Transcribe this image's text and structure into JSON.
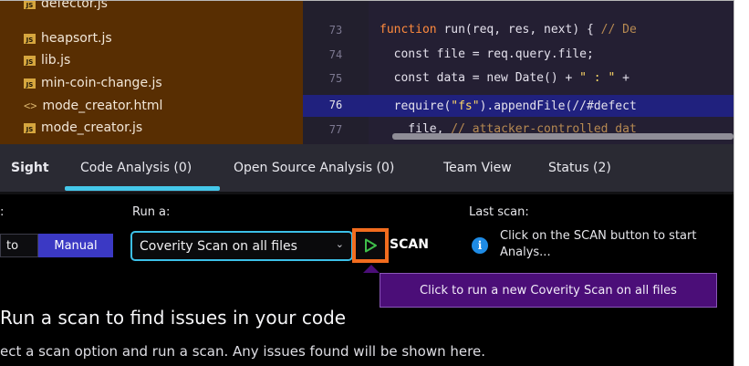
{
  "file_tree": {
    "items": [
      {
        "name": "defector.js",
        "type": "js"
      },
      {
        "name": "heapsort.js",
        "type": "js"
      },
      {
        "name": "lib.js",
        "type": "js"
      },
      {
        "name": "min-coin-change.js",
        "type": "js"
      },
      {
        "name": "mode_creator.html",
        "type": "html"
      },
      {
        "name": "mode_creator.js",
        "type": "js"
      }
    ],
    "js_badge": "JS",
    "html_badge": "<>"
  },
  "editor": {
    "line_numbers": [
      "73",
      "74",
      "75",
      "76",
      "77"
    ],
    "active_line": "76",
    "lines": [
      {
        "kw": "function",
        "rest": " run(req, res, next) { ",
        "cmt": "// De"
      },
      {
        "kw": "",
        "rest": "  const file = req.query.file;",
        "cmt": ""
      },
      {
        "kw": "",
        "rest": "  const data = new Date() + ",
        "str": "\" : \"",
        "tail": " +"
      },
      {
        "kw": "",
        "rest": "  require(",
        "str": "\"fs\"",
        "tail": ").appendFile(//#defect"
      },
      {
        "kw": "",
        "rest": "    file, ",
        "cmt": "// attacker-controlled dat"
      }
    ]
  },
  "tabs": [
    {
      "label": "Sight"
    },
    {
      "label": "Code Analysis (0)"
    },
    {
      "label": "Open Source Analysis (0)"
    },
    {
      "label": "Team View"
    },
    {
      "label": "Status (2)"
    }
  ],
  "scan_panel": {
    "mode_label_fragment": ":",
    "mode_auto": "to",
    "mode_manual": "Manual",
    "run_label": "Run a:",
    "run_select_value": "Coverity Scan on all files",
    "scan_button": "SCAN",
    "last_scan_label": "Last scan:",
    "last_scan_info": "Click on the SCAN button to start Analys...",
    "tooltip": "Click to run a new Coverity Scan on all files"
  },
  "empty_state": {
    "title": "Run a scan to find issues in your code",
    "subtitle": "ect a scan option and run a scan. Any issues found will be shown here."
  },
  "colors": {
    "accent": "#44c7e9",
    "play_highlight": "#f26c1e",
    "tooltip_bg": "#4b0e78",
    "manual_bg": "#3b39c4"
  }
}
